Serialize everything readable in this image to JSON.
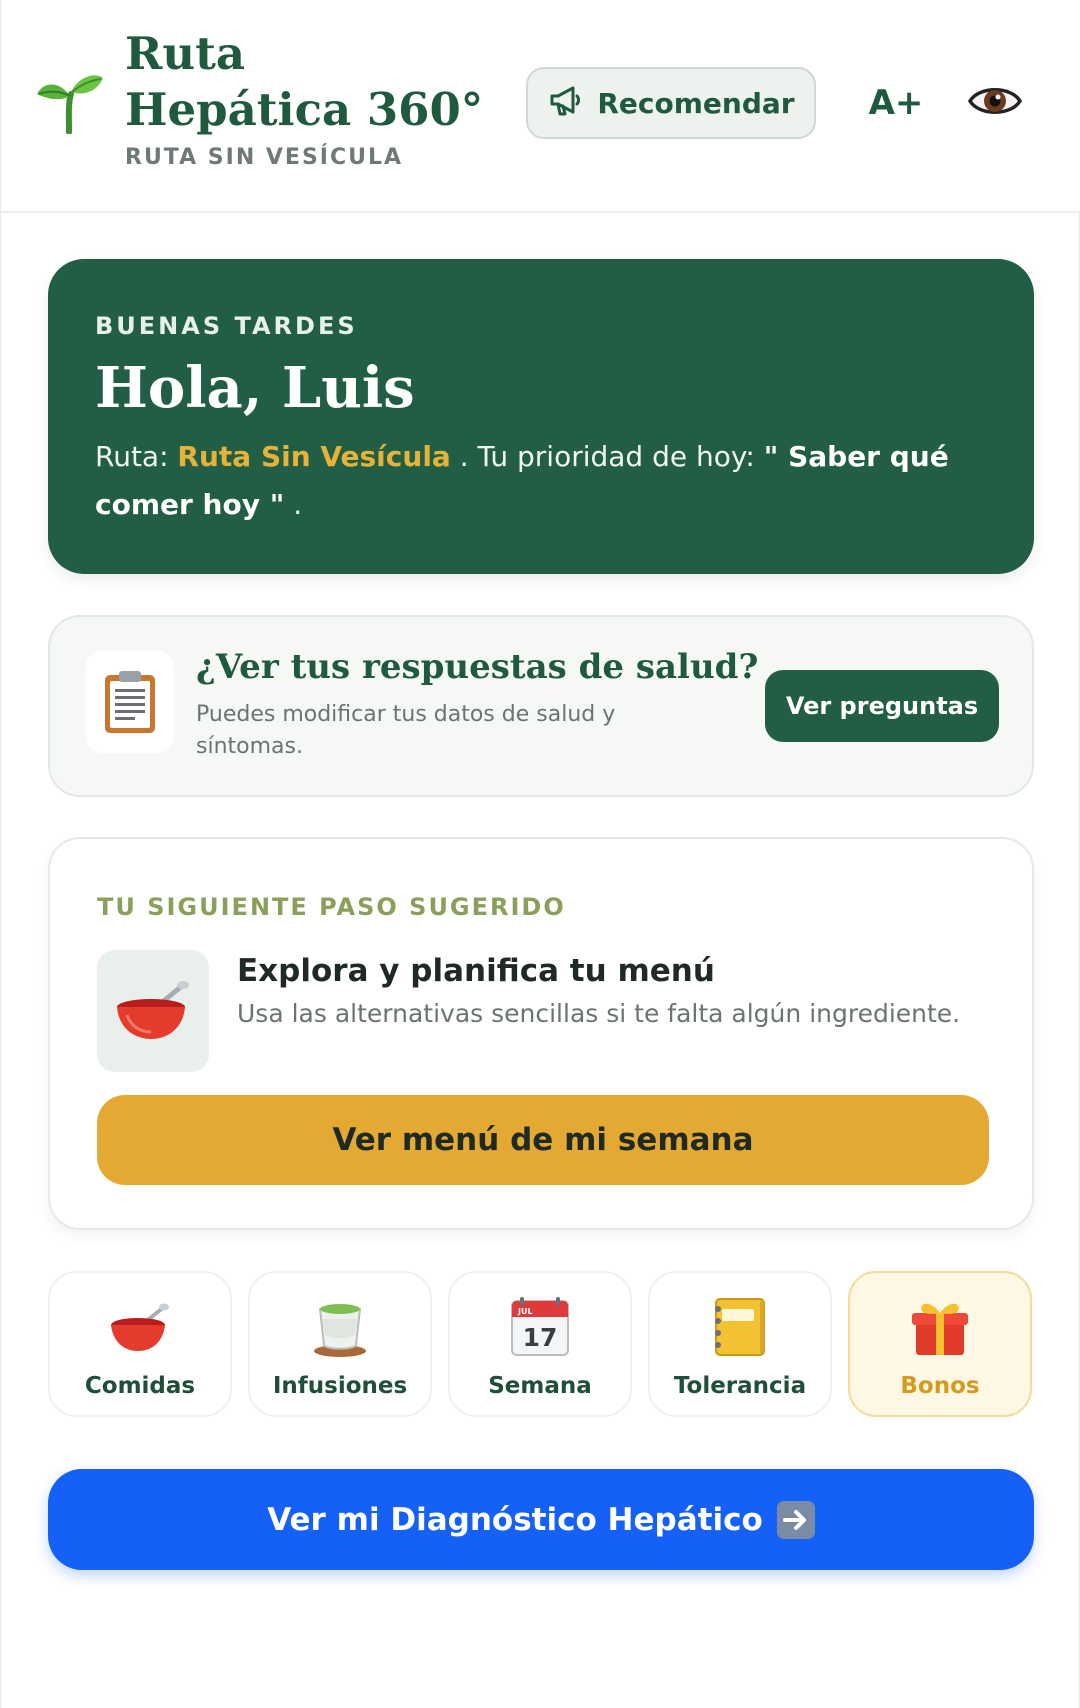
{
  "header": {
    "brand_title": "Ruta Hepática 360°",
    "brand_subtitle": "RUTA SIN VESÍCULA",
    "recommend_label": "Recomendar",
    "font_size_label": "A+",
    "logo_icon": "sprout-icon",
    "eye_icon": "eye-icon",
    "megaphone_icon": "megaphone-icon"
  },
  "greeting": {
    "kicker": "BUENAS TARDES",
    "title": "Hola, Luis",
    "route_prefix": "Ruta: ",
    "route_name": "Ruta Sin Vesícula",
    "priority_prefix": " . Tu prioridad de hoy: ",
    "priority": "\" Saber qué comer hoy \"",
    "suffix": " ."
  },
  "health": {
    "icon": "clipboard-icon",
    "title": "¿Ver tus respuestas de salud?",
    "description": "Puedes modificar tus datos de salud y síntomas.",
    "button_label": "Ver preguntas"
  },
  "next_step": {
    "kicker": "TU SIGUIENTE PASO SUGERIDO",
    "icon": "bowl-icon",
    "title": "Explora y planifica tu menú",
    "description": "Usa las alternativas sencillas si te falta algún ingrediente.",
    "button_label": "Ver menú de mi semana"
  },
  "tiles": [
    {
      "label": "Comidas",
      "icon": "bowl-icon"
    },
    {
      "label": "Infusiones",
      "icon": "tea-icon"
    },
    {
      "label": "Semana",
      "icon": "calendar-icon",
      "calendar_month": "JUL",
      "calendar_day": "17"
    },
    {
      "label": "Tolerancia",
      "icon": "notebook-icon"
    },
    {
      "label": "Bonos",
      "icon": "gift-icon",
      "active": true
    }
  ],
  "diagnostic": {
    "button_label": "Ver mi Diagnóstico Hepático",
    "icon": "arrow-right-icon"
  },
  "colors": {
    "brand_green": "#215e45",
    "accent_gold": "#e4a933",
    "primary_blue": "#1560f7"
  }
}
